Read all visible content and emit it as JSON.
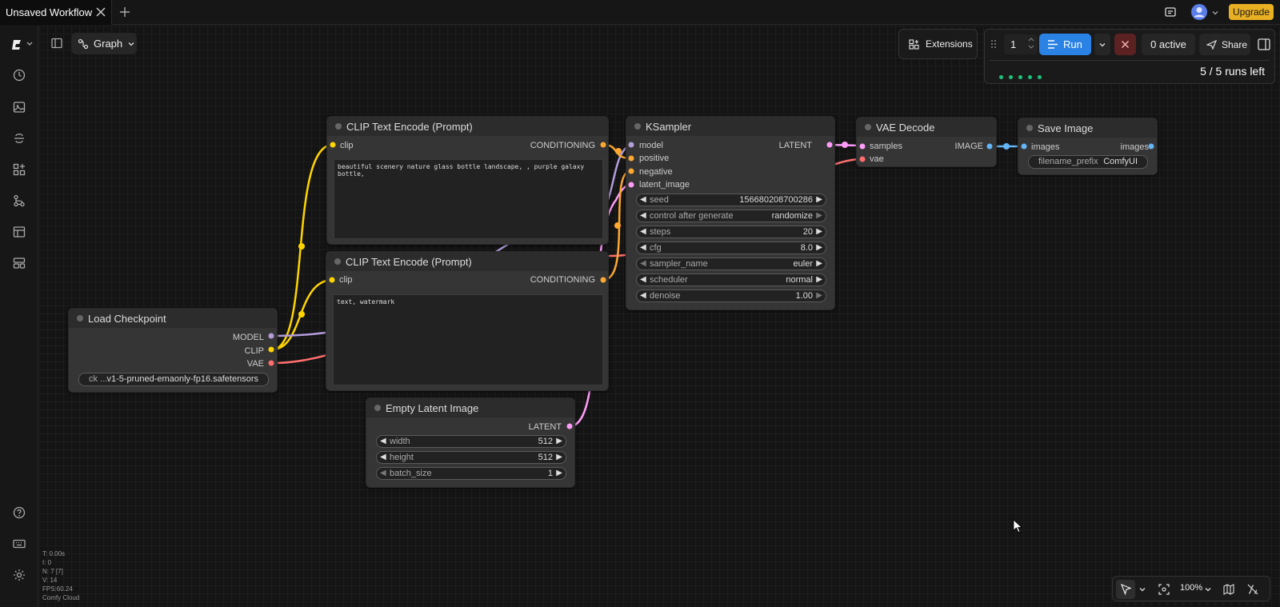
{
  "tab": {
    "title": "Unsaved Workflow"
  },
  "topbar": {
    "upgrade_label": "Upgrade"
  },
  "toolbar": {
    "graph_label": "Graph",
    "extensions_label": "Extensions"
  },
  "run_panel": {
    "queue_count": "1",
    "run_label": "Run",
    "active_label": "0 active",
    "share_label": "Share",
    "runs_left": "5 / 5 runs left"
  },
  "nodes": {
    "clip1": {
      "title": "CLIP Text Encode (Prompt)",
      "input": "clip",
      "output": "CONDITIONING",
      "text": "beautiful scenery nature glass bottle landscape, , purple galaxy bottle,"
    },
    "clip2": {
      "title": "CLIP Text Encode (Prompt)",
      "input": "clip",
      "output": "CONDITIONING",
      "text": "text, watermark"
    },
    "ksampler": {
      "title": "KSampler",
      "inputs": [
        "model",
        "positive",
        "negative",
        "latent_image"
      ],
      "output": "LATENT",
      "widgets": [
        {
          "label": "seed",
          "value": "156680208700286"
        },
        {
          "label": "control after generate",
          "value": "randomize"
        },
        {
          "label": "steps",
          "value": "20"
        },
        {
          "label": "cfg",
          "value": "8.0"
        },
        {
          "label": "sampler_name",
          "value": "euler"
        },
        {
          "label": "scheduler",
          "value": "normal"
        },
        {
          "label": "denoise",
          "value": "1.00"
        }
      ]
    },
    "vae_decode": {
      "title": "VAE Decode",
      "inputs": [
        "samples",
        "vae"
      ],
      "output": "IMAGE"
    },
    "save_image": {
      "title": "Save Image",
      "input": "images",
      "output": "images",
      "widget_label": "filename_prefix",
      "widget_value": "ComfyUI"
    },
    "checkpoint": {
      "title": "Load Checkpoint",
      "outputs": [
        "MODEL",
        "CLIP",
        "VAE"
      ],
      "widget_label": "ck ...",
      "widget_value": "v1-5-pruned-emaonly-fp16.safetensors"
    },
    "latent": {
      "title": "Empty Latent Image",
      "output": "LATENT",
      "widgets": [
        {
          "label": "width",
          "value": "512"
        },
        {
          "label": "height",
          "value": "512"
        },
        {
          "label": "batch_size",
          "value": "1"
        }
      ]
    }
  },
  "stats": [
    "T: 0.00s",
    "I: 0",
    "N: 7 [7]",
    "V: 14",
    "FPS:60.24",
    "Comfy Cloud"
  ],
  "zoom": "100%",
  "colors": {
    "clip_wire": "#ffd500",
    "model_wire": "#b39ddb",
    "vae_wire": "#ff6e6e",
    "latent_wire": "#ff9cf9",
    "cond_wire": "#ffa931",
    "image_wire": "#64b5f6",
    "accent": "#2a82e4",
    "upgrade": "#e8b022"
  }
}
